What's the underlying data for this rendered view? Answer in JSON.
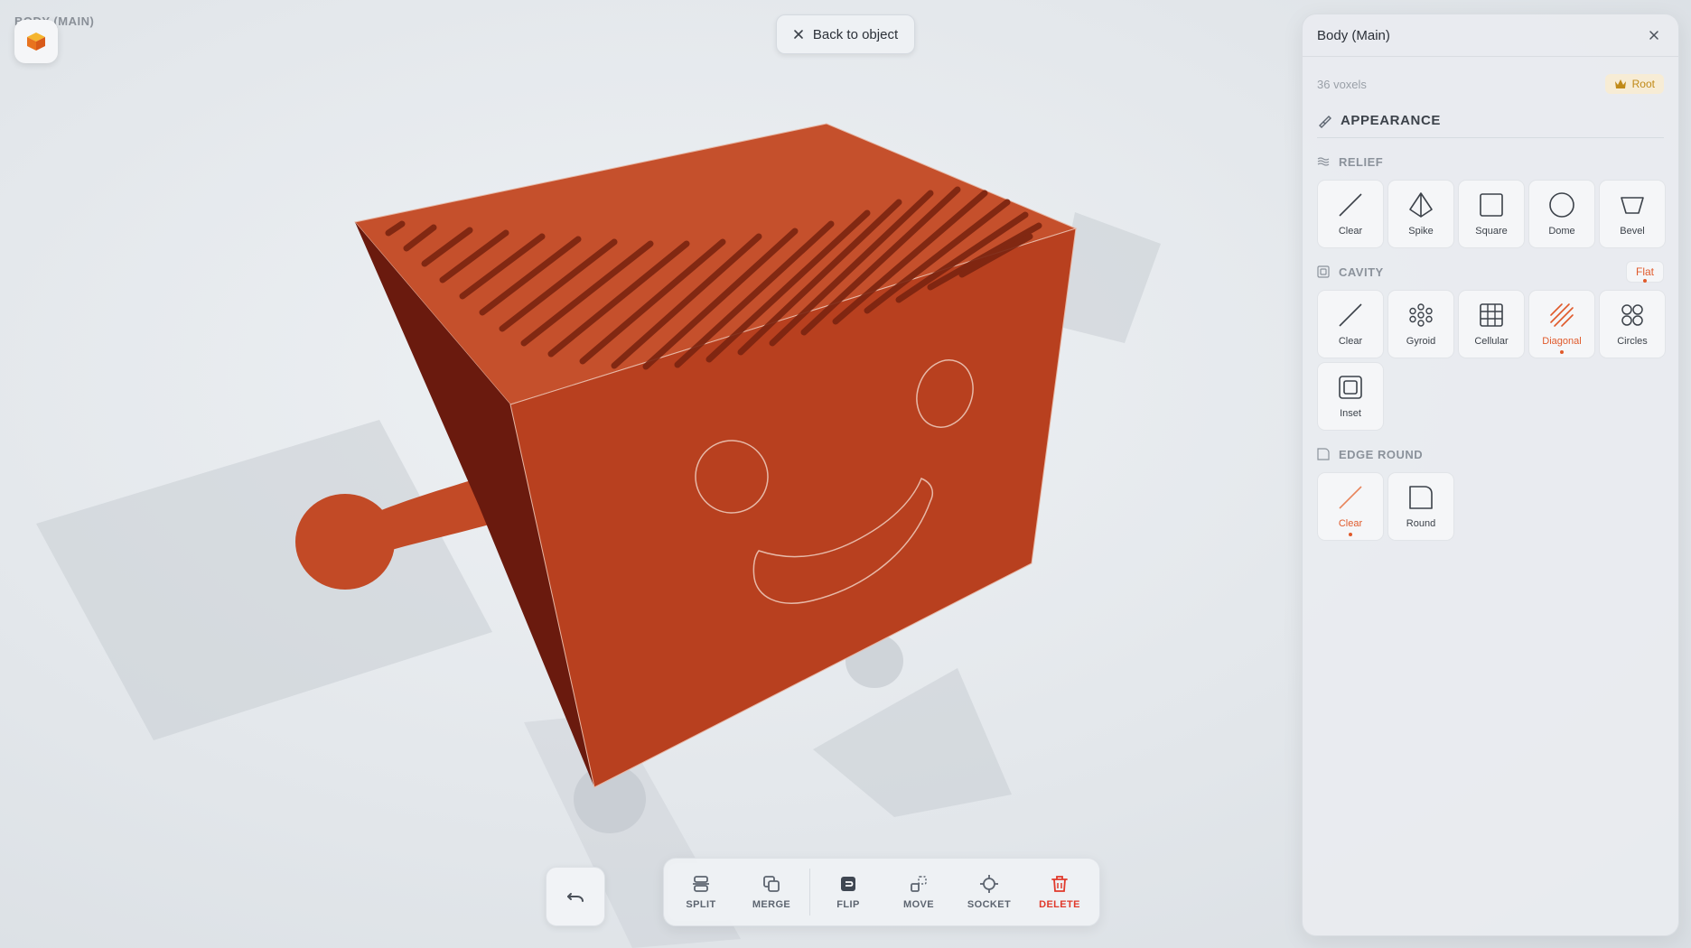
{
  "viewport": {
    "ghost_title": "BODY (MAIN)",
    "back_button": {
      "label": "Back to object",
      "icon": "close-icon"
    }
  },
  "toolbar": {
    "undo": {
      "icon": "undo-icon"
    },
    "tools": [
      {
        "label": "SPLIT",
        "icon": "split-icon"
      },
      {
        "label": "MERGE",
        "icon": "merge-icon"
      },
      {
        "label": "FLIP",
        "icon": "flip-icon"
      },
      {
        "label": "MOVE",
        "icon": "move-icon"
      },
      {
        "label": "SOCKET",
        "icon": "socket-icon"
      },
      {
        "label": "DELETE",
        "icon": "trash-icon"
      }
    ]
  },
  "panel": {
    "title": "Body (Main)",
    "voxels": "36 voxels",
    "root_badge": "Root",
    "section": "APPEARANCE",
    "relief": {
      "title": "RELIEF",
      "options": [
        "Clear",
        "Spike",
        "Square",
        "Dome",
        "Bevel"
      ]
    },
    "cavity": {
      "title": "CAVITY",
      "mode": "Flat",
      "options": [
        "Clear",
        "Gyroid",
        "Cellular",
        "Diagonal",
        "Circles",
        "Inset"
      ],
      "selected": "Diagonal"
    },
    "edge_round": {
      "title": "EDGE ROUND",
      "options": [
        "Clear",
        "Round"
      ],
      "selected": "Clear"
    }
  },
  "colors": {
    "accent": "#e05a2b",
    "object_front": "#b8401f",
    "object_top": "#c5502c",
    "object_side": "#6a1a0e",
    "root_badge": "#c08a18"
  }
}
